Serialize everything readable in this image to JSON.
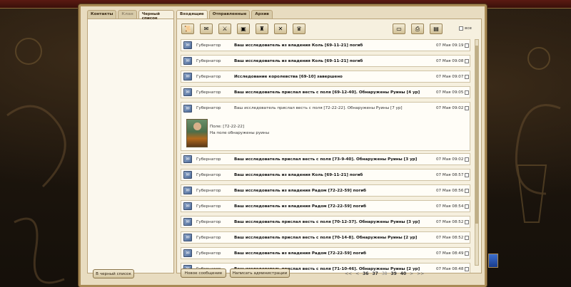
{
  "left_tabs": [
    {
      "label": "Контакты",
      "state": "normal"
    },
    {
      "label": "Клан",
      "state": "disabled"
    },
    {
      "label": "Черный список",
      "state": "active"
    }
  ],
  "blacklist_button": "В черный список",
  "right_tabs": [
    {
      "label": "Входящие",
      "state": "active"
    },
    {
      "label": "Отправленные",
      "state": "normal"
    },
    {
      "label": "Архив",
      "state": "normal"
    }
  ],
  "toolbar": {
    "filter_icons": [
      "scroll-icon",
      "letter-icon",
      "sword-icon",
      "chest-icon",
      "castle-icon",
      "crossed-swords-icon",
      "trophy-icon"
    ],
    "action_icons": [
      "archive-icon",
      "print-icon",
      "delete-icon"
    ],
    "all_label": "все"
  },
  "messages": [
    {
      "from": "Губернатор",
      "subject": "Ваш исследователь из владения Коль [69-11-21] погиб",
      "date": "07 Мая 09:19"
    },
    {
      "from": "Губернатор",
      "subject": "Ваш исследователь из владения Коль [69-11-21] погиб",
      "date": "07 Мая 09:08"
    },
    {
      "from": "Губернатор",
      "subject": "Исследование королевства [69-10] завершено",
      "date": "07 Мая 09:07"
    },
    {
      "from": "Губернатор",
      "subject": "Ваш исследователь прислал весть с поля [69-12-40]. Обнаружены Руины [4 ур]",
      "date": "07 Мая 09:05"
    },
    {
      "from": "Губернатор",
      "subject": "Ваш исследователь прислал весть с поля [72-22-22]. Обнаружены Руины [7 ур]",
      "date": "07 Мая 09:02",
      "expanded": true,
      "body": [
        "Поле: [72-22-22]",
        "На поле обнаружены руины"
      ]
    },
    {
      "from": "Губернатор",
      "subject": "Ваш исследователь прислал весть с поля [73-9-40]. Обнаружены Руины [3 ур]",
      "date": "07 Мая 09:02"
    },
    {
      "from": "Губернатор",
      "subject": "Ваш исследователь из владения Коль [69-11-21] погиб",
      "date": "07 Мая 08:57"
    },
    {
      "from": "Губернатор",
      "subject": "Ваш исследователь из владения Радом [72-22-59] погиб",
      "date": "07 Мая 08:56"
    },
    {
      "from": "Губернатор",
      "subject": "Ваш исследователь из владения Радом [72-22-59] погиб",
      "date": "07 Мая 08:54"
    },
    {
      "from": "Губернатор",
      "subject": "Ваш исследователь прислал весть с поля [70-12-37]. Обнаружены Руины [3 ур]",
      "date": "07 Мая 08:52"
    },
    {
      "from": "Губернатор",
      "subject": "Ваш исследователь прислал весть с поля [70-14-8]. Обнаружены Руины [2 ур]",
      "date": "07 Мая 08:52"
    },
    {
      "from": "Губернатор",
      "subject": "Ваш исследователь из владения Радом [72-22-59] погиб",
      "date": "07 Мая 08:49"
    },
    {
      "from": "Губернатор",
      "subject": "Ваш исследователь прислал весть с поля [71-10-46]. Обнаружены Руины [2 ур]",
      "date": "07 Мая 08:48"
    }
  ],
  "buttons": {
    "new_message": "Новое сообщение",
    "write_admin": "Написать администрации"
  },
  "pager": {
    "first": "<<",
    "prev": "<",
    "pages": [
      "36",
      "37",
      "38",
      "39",
      "40"
    ],
    "current": "38",
    "next": ">",
    "last": ">>"
  }
}
